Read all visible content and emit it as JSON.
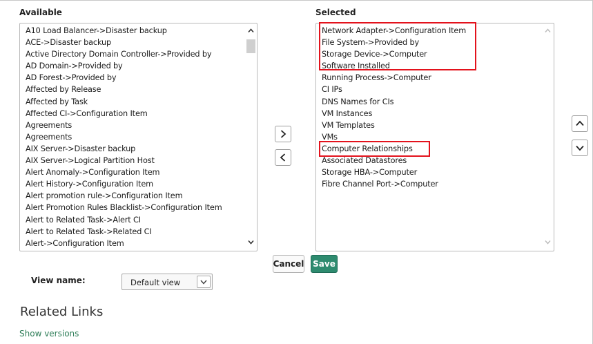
{
  "available": {
    "title": "Available",
    "items": [
      "A10 Load Balancer->Disaster backup",
      "ACE->Disaster backup",
      "Active Directory Domain Controller->Provided by",
      "AD Domain->Provided by",
      "AD Forest->Provided by",
      "Affected by Release",
      "Affected by Task",
      "Affected CI->Configuration Item",
      "Agreements",
      "Agreements",
      "AIX Server->Disaster backup",
      "AIX Server->Logical Partition Host",
      "Alert Anomaly->Configuration Item",
      "Alert History->Configuration Item",
      "Alert promotion rule->Configuration Item",
      "Alert Promotion Rules Blacklist->Configuration Item",
      "Alert to Related Task->Alert CI",
      "Alert to Related Task->Related CI",
      "Alert->Configuration Item"
    ]
  },
  "selected": {
    "title": "Selected",
    "items": [
      "Network Adapter->Configuration Item",
      "File System->Provided by",
      "Storage Device->Computer",
      "Software Installed",
      "Running Process->Computer",
      "CI IPs",
      "DNS Names for CIs",
      "VM Instances",
      "VM Templates",
      "VMs",
      "Computer Relationships",
      "Associated Datastores",
      "Storage HBA->Computer",
      "Fibre Channel Port->Computer"
    ]
  },
  "buttons": {
    "cancel": "Cancel",
    "save": "Save"
  },
  "view": {
    "label": "View name:",
    "value": "Default view"
  },
  "related": {
    "title": "Related Links",
    "link": "Show versions"
  },
  "colors": {
    "highlight": "#e3121c",
    "save_bg": "#2e8b6f",
    "link": "#2e7d57"
  },
  "icons": {
    "add": "chevron-right-icon",
    "remove": "chevron-left-icon",
    "move_up": "chevron-up-icon",
    "move_down": "chevron-down-icon"
  }
}
